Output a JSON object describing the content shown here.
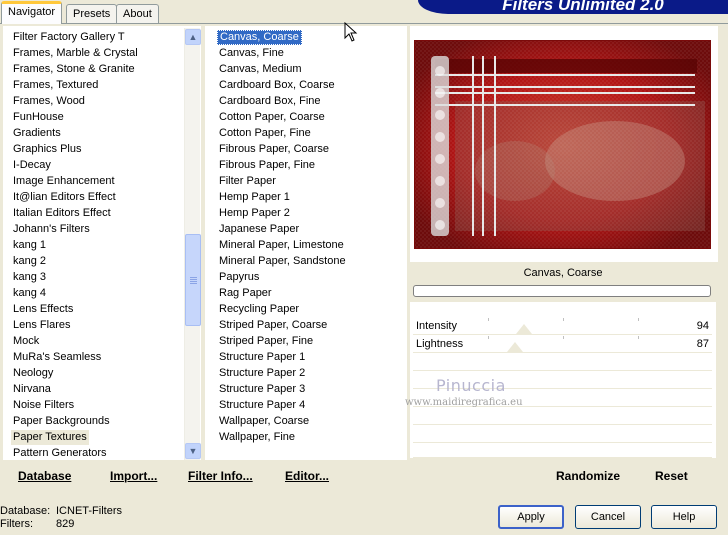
{
  "tabs": [
    {
      "label": "Navigator",
      "active": true
    },
    {
      "label": "Presets",
      "active": false
    },
    {
      "label": "About",
      "active": false
    }
  ],
  "banner": {
    "title": "Filters Unlimited 2.0"
  },
  "categories": {
    "items": [
      "Filter Factory Gallery T",
      "Frames, Marble & Crystal",
      "Frames, Stone & Granite",
      "Frames, Textured",
      "Frames, Wood",
      "FunHouse",
      "Gradients",
      "Graphics Plus",
      "I-Decay",
      "Image Enhancement",
      "It@lian Editors Effect",
      "Italian Editors Effect",
      "Johann's Filters",
      "kang 1",
      "kang 2",
      "kang 3",
      "kang 4",
      "Lens Effects",
      "Lens Flares",
      "Mock",
      "MuRa's Seamless",
      "Neology",
      "Nirvana",
      "Noise Filters",
      "Paper Backgrounds",
      "Paper Textures",
      "Pattern Generators"
    ],
    "selected": "Paper Textures"
  },
  "filters": {
    "items": [
      "Canvas, Coarse",
      "Canvas, Fine",
      "Canvas, Medium",
      "Cardboard Box, Coarse",
      "Cardboard Box, Fine",
      "Cotton Paper, Coarse",
      "Cotton Paper, Fine",
      "Fibrous Paper, Coarse",
      "Fibrous Paper, Fine",
      "Filter Paper",
      "Hemp Paper 1",
      "Hemp Paper 2",
      "Japanese Paper",
      "Mineral Paper, Limestone",
      "Mineral Paper, Sandstone",
      "Papyrus",
      "Rag Paper",
      "Recycling Paper",
      "Striped Paper, Coarse",
      "Striped Paper, Fine",
      "Structure Paper 1",
      "Structure Paper 2",
      "Structure Paper 3",
      "Structure Paper 4",
      "Wallpaper, Coarse",
      "Wallpaper, Fine"
    ],
    "selected": "Canvas, Coarse"
  },
  "preview": {
    "filter_name": "Canvas, Coarse",
    "colors": {
      "base": "#b01010",
      "dark": "#6a0606",
      "light": "#e8e8e8"
    }
  },
  "params": [
    {
      "label": "Intensity",
      "value": "94",
      "level": 0.37
    },
    {
      "label": "Lightness",
      "value": "87",
      "level": 0.34
    }
  ],
  "watermark": {
    "name": "Pinuccia",
    "url": "www.maidiregrafica.eu"
  },
  "left_buttons": {
    "database": "Database",
    "import": "Import...",
    "filter_info": "Filter Info...",
    "editor": "Editor..."
  },
  "right_buttons": {
    "randomize": "Randomize",
    "reset": "Reset"
  },
  "info": {
    "database_label": "Database:",
    "database_value": "ICNET-Filters",
    "filters_label": "Filters:",
    "filters_value": "829"
  },
  "dialog_buttons": {
    "apply": "Apply",
    "cancel": "Cancel",
    "help": "Help"
  }
}
